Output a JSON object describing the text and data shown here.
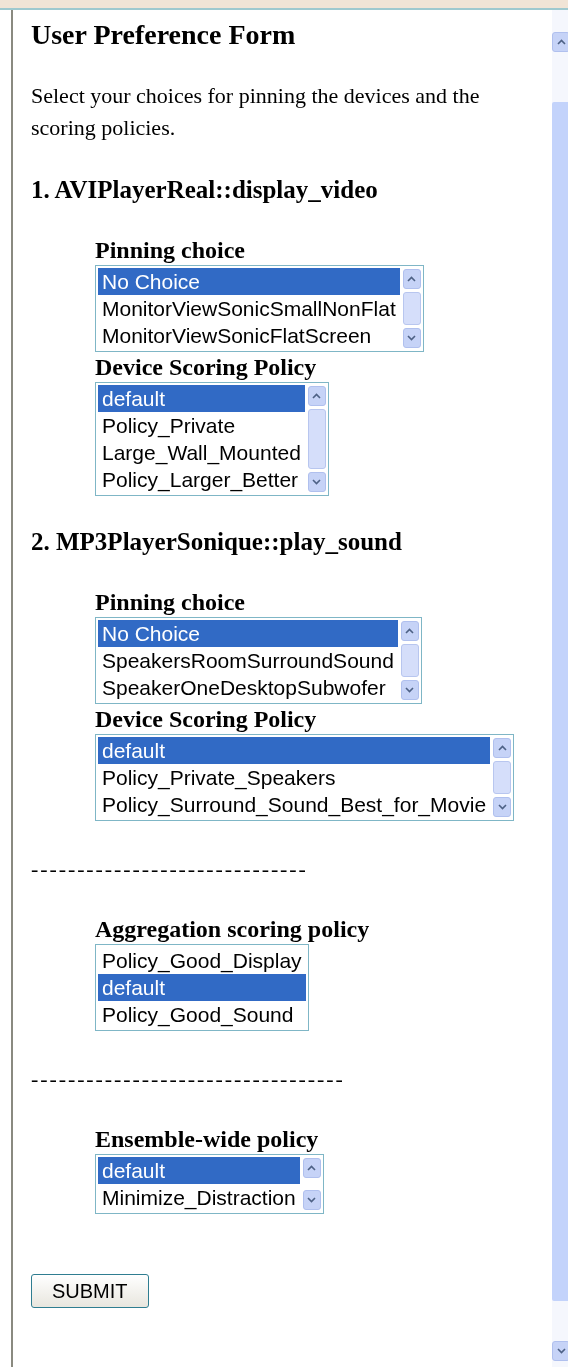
{
  "title": "User Preference Form",
  "intro": "Select your choices for pinning the devices and the scoring policies.",
  "sections": [
    {
      "heading": "1. AVIPlayerReal::display_video",
      "lists": [
        {
          "label": "Pinning choice",
          "scrollable": true,
          "options": [
            {
              "text": "No Choice",
              "selected": true
            },
            {
              "text": "MonitorViewSonicSmallNonFlat",
              "selected": false
            },
            {
              "text": "MonitorViewSonicFlatScreen",
              "selected": false
            }
          ]
        },
        {
          "label": "Device Scoring Policy",
          "scrollable": true,
          "options": [
            {
              "text": "default",
              "selected": true
            },
            {
              "text": "Policy_Private",
              "selected": false
            },
            {
              "text": "Large_Wall_Mounted",
              "selected": false
            },
            {
              "text": "Policy_Larger_Better",
              "selected": false
            }
          ]
        }
      ]
    },
    {
      "heading": "2. MP3PlayerSonique::play_sound",
      "lists": [
        {
          "label": "Pinning choice",
          "scrollable": true,
          "options": [
            {
              "text": "No Choice",
              "selected": true
            },
            {
              "text": "SpeakersRoomSurroundSound",
              "selected": false
            },
            {
              "text": "SpeakerOneDesktopSubwofer",
              "selected": false
            }
          ]
        },
        {
          "label": "Device Scoring Policy",
          "scrollable": true,
          "options": [
            {
              "text": "default",
              "selected": true
            },
            {
              "text": "Policy_Private_Speakers",
              "selected": false
            },
            {
              "text": "Policy_Surround_Sound_Best_for_Movie",
              "selected": false
            }
          ]
        }
      ]
    }
  ],
  "extras": [
    {
      "divider": "------------------------------",
      "label": "Aggregation scoring policy",
      "scrollable": false,
      "options": [
        {
          "text": "Policy_Good_Display",
          "selected": false
        },
        {
          "text": "default",
          "selected": true
        },
        {
          "text": "Policy_Good_Sound",
          "selected": false
        }
      ]
    },
    {
      "divider": "----------------------------------",
      "label": "Ensemble-wide policy",
      "scrollable": true,
      "options": [
        {
          "text": "default",
          "selected": true
        },
        {
          "text": "Minimize_Distraction",
          "selected": false
        }
      ]
    }
  ],
  "submit": "SUBMIT"
}
